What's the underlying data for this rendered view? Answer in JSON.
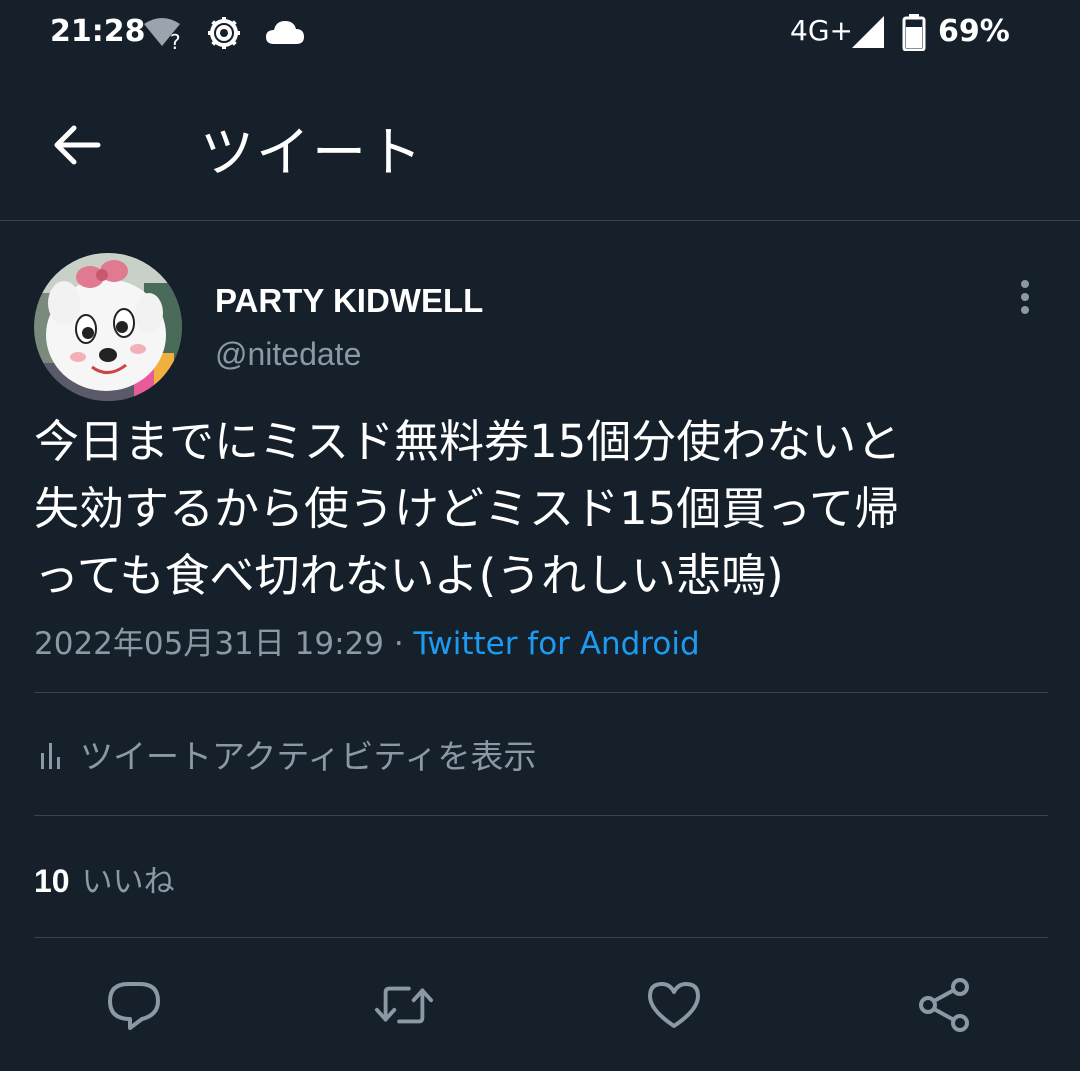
{
  "status_bar": {
    "time": "21:28",
    "network": "4G+",
    "battery": "69%",
    "icons": [
      "wifi-unknown-icon",
      "settings-gear-icon",
      "cloud-icon",
      "signal-icon",
      "battery-icon"
    ]
  },
  "header": {
    "title": "ツイート",
    "back_icon": "arrow-left-icon"
  },
  "tweet": {
    "display_name": "PARTY KIDWELL",
    "handle": "@nitedate",
    "text": "今日までにミスド無料券15個分使わないと\n失効するから使うけどミスド15個買って帰\nっても食べ切れないよ(うれしい悲鳴)",
    "timestamp": "2022年05月31日 19:29",
    "separator": " · ",
    "source": "Twitter for Android"
  },
  "activity": {
    "label": "ツイートアクティビティを表示"
  },
  "stats": {
    "likes_count": "10",
    "likes_label": "いいね"
  },
  "actions": [
    "reply-icon",
    "retweet-icon",
    "like-icon",
    "share-icon"
  ],
  "colors": {
    "background": "#15202b",
    "divider": "#38444d",
    "secondary_text": "#8b98a5",
    "link": "#1d9bf0"
  }
}
